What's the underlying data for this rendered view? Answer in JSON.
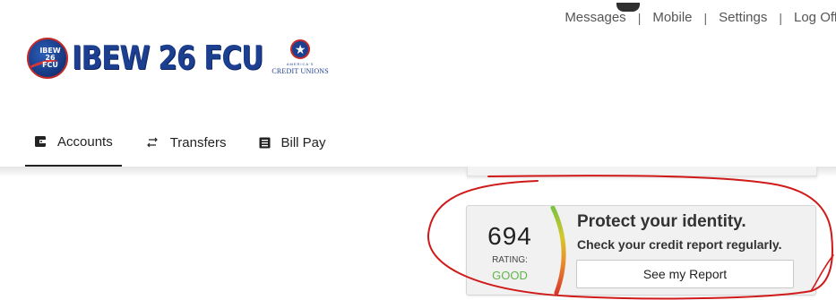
{
  "top_links": {
    "messages": "Messages",
    "mobile": "Mobile",
    "settings": "Settings",
    "logoff": "Log Off",
    "separator": "|"
  },
  "logo": {
    "seal_text_1": "IBEW",
    "seal_text_2": "26",
    "seal_text_3": "FCU",
    "wordmark": "IBEW 26 FCU",
    "cu_americas": "AMERICA'S",
    "cu_text": "CREDIT UNIONS"
  },
  "nav": {
    "tabs": [
      {
        "label": "Accounts",
        "icon": "wallet-icon",
        "active": true
      },
      {
        "label": "Transfers",
        "icon": "arrows-icon",
        "active": false
      },
      {
        "label": "Bill Pay",
        "icon": "bill-icon",
        "active": false
      }
    ]
  },
  "credit": {
    "score": "694",
    "rating_label": "RATING:",
    "rating": "GOOD",
    "title": "Protect your identity.",
    "subtitle": "Check your credit report regularly.",
    "button_label": "See my Report"
  },
  "colors": {
    "brand_blue": "#1d3f8f",
    "brand_red": "#c22a2a",
    "rating_good": "#62b44a",
    "annotation_red": "#d01a1a"
  }
}
